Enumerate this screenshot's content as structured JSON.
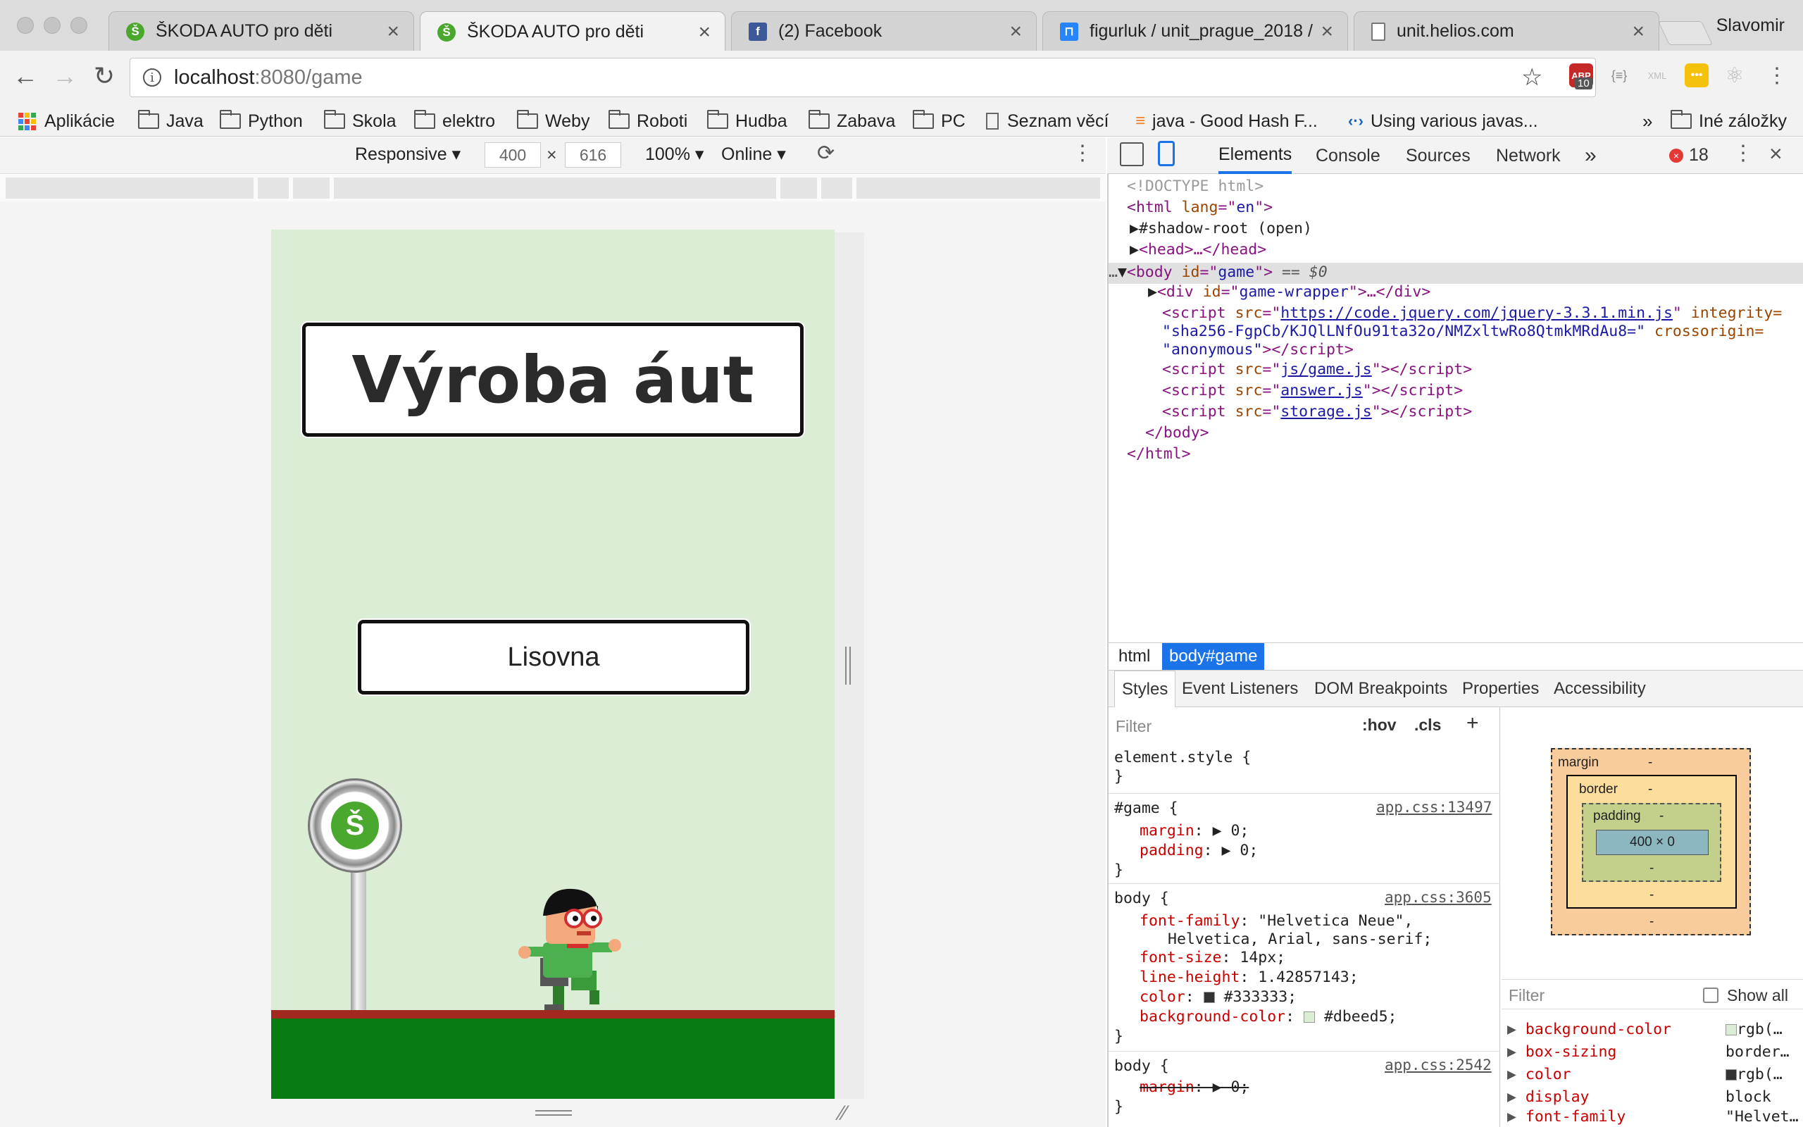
{
  "window": {
    "profile_name": "Slavomir"
  },
  "tabs": [
    {
      "title": "ŠKODA AUTO pro děti",
      "favicon": "skoda-icon",
      "active": false
    },
    {
      "title": "ŠKODA AUTO pro děti",
      "favicon": "skoda-icon",
      "active": true
    },
    {
      "title": "(2) Facebook",
      "favicon": "facebook-icon",
      "active": false
    },
    {
      "title": "figurluk / unit_prague_2018 /",
      "favicon": "bitbucket-icon",
      "active": false
    },
    {
      "title": "unit.helios.com",
      "favicon": "page-icon",
      "active": false
    }
  ],
  "omnibox": {
    "host": "localhost",
    "path": ":8080/game"
  },
  "extensions": {
    "badge_count": "10",
    "abp_label": "ABP",
    "json_label": "{≡}",
    "xml_label": "XML"
  },
  "bookmarks": [
    {
      "label": "Aplikácie",
      "icon": "apps-icon"
    },
    {
      "label": "Java",
      "icon": "folder-icon"
    },
    {
      "label": "Python",
      "icon": "folder-icon"
    },
    {
      "label": "Skola",
      "icon": "folder-icon"
    },
    {
      "label": "elektro",
      "icon": "folder-icon"
    },
    {
      "label": "Weby",
      "icon": "folder-icon"
    },
    {
      "label": "Roboti",
      "icon": "folder-icon"
    },
    {
      "label": "Hudba",
      "icon": "folder-icon"
    },
    {
      "label": "Zabava",
      "icon": "folder-icon"
    },
    {
      "label": "PC",
      "icon": "folder-icon"
    },
    {
      "label": "Seznam věcí",
      "icon": "page-icon"
    },
    {
      "label": "java - Good Hash F...",
      "icon": "stackoverflow-icon"
    },
    {
      "label": "Using various javas...",
      "icon": "code-icon"
    },
    {
      "label": "Iné záložky",
      "icon": "folder-icon"
    }
  ],
  "device_toolbar": {
    "mode": "Responsive ▾",
    "width": "400",
    "times": "×",
    "height": "616",
    "zoom": "100% ▾",
    "network": "Online ▾"
  },
  "game": {
    "title": "Výroba áut",
    "button_label": "Lisovna",
    "background_color": "#dbeed5",
    "ground_color": "#087b13",
    "ground_edge_color": "#a1291f",
    "sign_logo_letter": "Š"
  },
  "devtools": {
    "tabs": [
      "Elements",
      "Console",
      "Sources",
      "Network"
    ],
    "more_tabs": "»",
    "error_count": "18",
    "dom_lines": {
      "doctype": "<!DOCTYPE html>",
      "html_open": [
        "<html ",
        "lang",
        "=\"",
        "en",
        "\">"
      ],
      "shadow_root": "#shadow-root (open)",
      "head": "<head>…</head>",
      "body_open": [
        "<body ",
        "id",
        "=\"",
        "game",
        "\">",
        " == $0"
      ],
      "div": [
        "<div ",
        "id",
        "=\"",
        "game-wrapper",
        "\">…</div>"
      ],
      "script1_src": "https://code.jquery.com/jquery-3.3.1.min.js",
      "script1_integrity_label": "integrity=",
      "script1_hash": "\"sha256-FgpCb/KJQlLNfOu91ta32o/NMZxltwRo8QtmkMRdAu8=\"",
      "script1_crossorigin": "crossorigin=",
      "script1_anon": "\"anonymous\"",
      "script2_src": "js/game.js",
      "script3_src": "answer.js",
      "script4_src": "storage.js",
      "body_close": "</body>",
      "html_close": "</html>"
    },
    "breadcrumbs": [
      "html",
      "body#game"
    ],
    "subtabs": [
      "Styles",
      "Event Listeners",
      "DOM Breakpoints",
      "Properties",
      "Accessibility"
    ],
    "styles": {
      "filter_placeholder": "Filter",
      "hov": ":hov",
      "cls": ".cls",
      "plus": "+",
      "element_style": "element.style {",
      "close_brace": "}",
      "rules": [
        {
          "selector": "#game {",
          "source": "app.css:13497",
          "props": [
            [
              "margin",
              "▶ 0;"
            ],
            [
              "padding",
              "▶ 0;"
            ]
          ]
        },
        {
          "selector": "body {",
          "source": "app.css:3605",
          "props": [
            [
              "font-family",
              "\"Helvetica Neue\","
            ],
            [
              "",
              "Helvetica, Arial, sans-serif;"
            ],
            [
              "font-size",
              "14px;"
            ],
            [
              "line-height",
              "1.42857143;"
            ],
            [
              "color",
              "#333333;"
            ],
            [
              "background-color",
              "#dbeed5;"
            ]
          ]
        },
        {
          "selector": "body {",
          "source": "app.css:2542",
          "props": [
            [
              "margin",
              "▶ 0;"
            ]
          ]
        }
      ]
    },
    "box_model": {
      "margin_label": "margin",
      "border_label": "border",
      "padding_label": "padding",
      "content": "400 × 0",
      "dash": "-"
    },
    "computed": {
      "filter_placeholder": "Filter",
      "show_all": "Show all",
      "rows": [
        {
          "prop": "background-color",
          "value": "rgb(…"
        },
        {
          "prop": "box-sizing",
          "value": "border…"
        },
        {
          "prop": "color",
          "value": "rgb(…"
        },
        {
          "prop": "display",
          "value": "block"
        },
        {
          "prop": "font-family",
          "value": "\"Helvet…"
        }
      ]
    }
  }
}
